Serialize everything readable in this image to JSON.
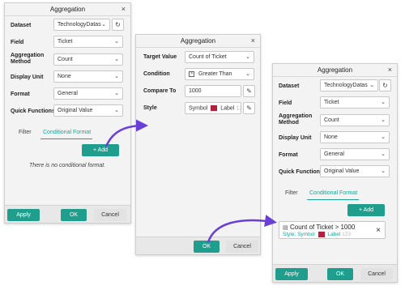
{
  "panel1": {
    "title": "Aggregation",
    "close": "×",
    "dataset_label": "Dataset",
    "dataset_value": "TechnologyDatas",
    "field_label": "Field",
    "field_value": "Ticket",
    "agg_label_1": "Aggregation",
    "agg_label_2": "Method",
    "agg_value": "Count",
    "display_label": "Display Unit",
    "display_value": "None",
    "format_label": "Format",
    "format_value": "General",
    "quick_label": "Quick Functions",
    "quick_value": "Original Value",
    "tab_filter": "Filter",
    "tab_conditional": "Conditional Format",
    "add_label": "+ Add",
    "empty": "There is no conditional format.",
    "apply": "Apply",
    "ok": "OK",
    "cancel": "Cancel"
  },
  "panel2": {
    "title": "Aggregation",
    "close": "×",
    "target_label": "Target Value",
    "target_value": "Count of Ticket",
    "condition_label": "Condition",
    "condition_value": "Greater Than",
    "compare_label": "Compare To",
    "compare_value": "1000",
    "style_label": "Style",
    "style_symbol": "Symbol",
    "style_label_text": "Label",
    "style_faint": "123",
    "ok": "OK",
    "cancel": "Cancel"
  },
  "panel3": {
    "title": "Aggregation",
    "close": "×",
    "dataset_label": "Dataset",
    "dataset_value": "TechnologyDatas",
    "field_label": "Field",
    "field_value": "Ticket",
    "agg_label_1": "Aggregation",
    "agg_label_2": "Method",
    "agg_value": "Count",
    "display_label": "Display Unit",
    "display_value": "None",
    "format_label": "Format",
    "format_value": "General",
    "quick_label": "Quick Functions",
    "quick_value": "Original Value",
    "tab_filter": "Filter",
    "tab_conditional": "Conditional Format",
    "add_label": "+ Add",
    "cf_title": "Count of Ticket > 1000",
    "cf_style": "Style:",
    "cf_symbol": "Symbol",
    "cf_label": "Label",
    "cf_faint": "123",
    "cf_remove": "×",
    "apply": "Apply",
    "ok": "OK",
    "cancel": "Cancel"
  },
  "colors": {
    "accent": "#1f9e8e",
    "arrow": "#6a3fd8",
    "swatch": "#b2213d"
  },
  "icons": {
    "chevron": "chevron-down-icon",
    "refresh": "refresh-icon",
    "edit": "edit-icon",
    "table": "table-icon"
  }
}
